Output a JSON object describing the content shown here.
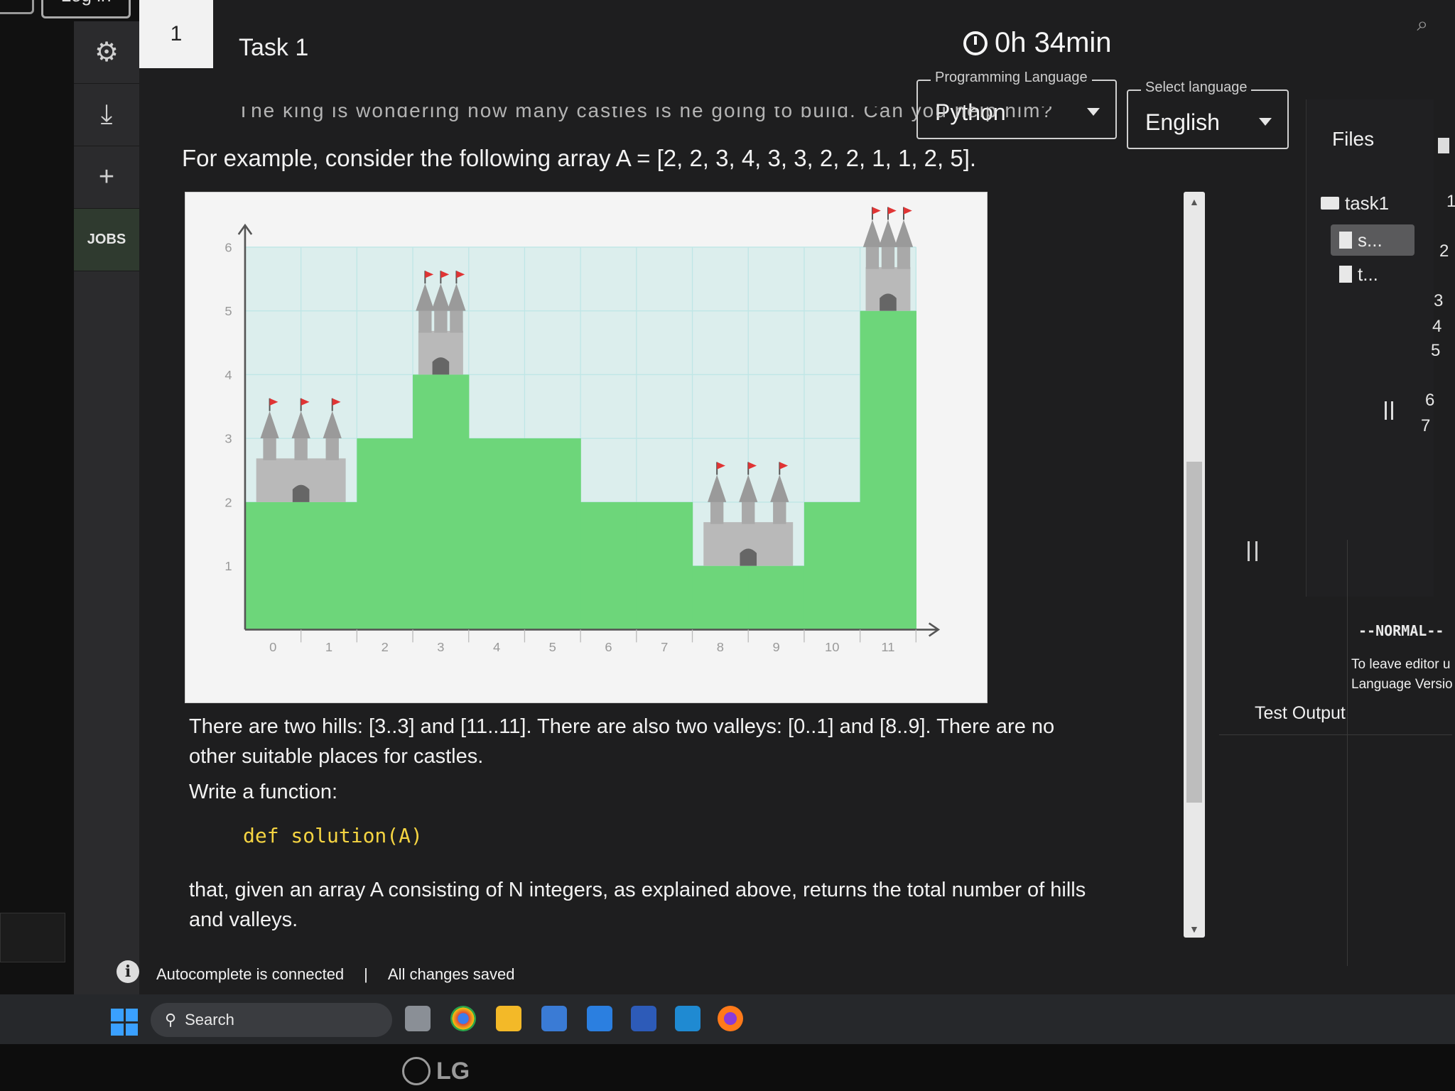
{
  "header": {
    "login_label": "Log in",
    "task_number": "1",
    "task_title": "Task 1",
    "timer": "0h 34min"
  },
  "selects": {
    "programming_language": {
      "legend": "Programming Language",
      "value": "Python"
    },
    "language": {
      "legend": "Select language",
      "value": "English"
    }
  },
  "rail": {
    "jobs_label": "JOBS"
  },
  "description": {
    "cut_line": "The king is wondering how many castles is he going to build. Can you help him?",
    "intro": "For example, consider the following array A = [2, 2, 3, 4, 3, 3, 2, 2, 1, 1, 2, 5].",
    "hills_text": "There are two hills: [3..3] and [11..11]. There are also two valleys: [0..1] and [8..9]. There are no other suitable places for castles.",
    "write_function": "Write a function:",
    "code": "def solution(A)",
    "given_text": "that, given an array A consisting of N integers, as explained above, returns the total number of hills and valleys."
  },
  "chart_data": {
    "type": "bar",
    "categories": [
      "0",
      "1",
      "2",
      "3",
      "4",
      "5",
      "6",
      "7",
      "8",
      "9",
      "10",
      "11"
    ],
    "values": [
      2,
      2,
      3,
      4,
      3,
      3,
      2,
      2,
      1,
      1,
      2,
      5
    ],
    "y_ticks": [
      "1",
      "2",
      "3",
      "4",
      "5",
      "6"
    ],
    "ylim": [
      0,
      6
    ],
    "grid": true,
    "colors": {
      "bar": "#6dd67a",
      "grid": "#bfe6e6",
      "plot_bg": "#dceeed",
      "castle": "#b9b9b9"
    }
  },
  "files": {
    "title": "Files",
    "folder": "task1",
    "items": [
      "s...",
      "t..."
    ]
  },
  "editor": {
    "line_numbers": [
      "1",
      "2",
      "3",
      "4",
      "5",
      "6",
      "7"
    ],
    "mode": "--NORMAL--",
    "hint_line1": "To leave editor u",
    "hint_line2": "Language Versio",
    "test_output": "Test Output"
  },
  "status": {
    "autocomplete": "Autocomplete is connected",
    "separator": "|",
    "saved": "All changes saved"
  },
  "taskbar": {
    "search": "Search"
  },
  "monitor": {
    "brand": "LG"
  }
}
